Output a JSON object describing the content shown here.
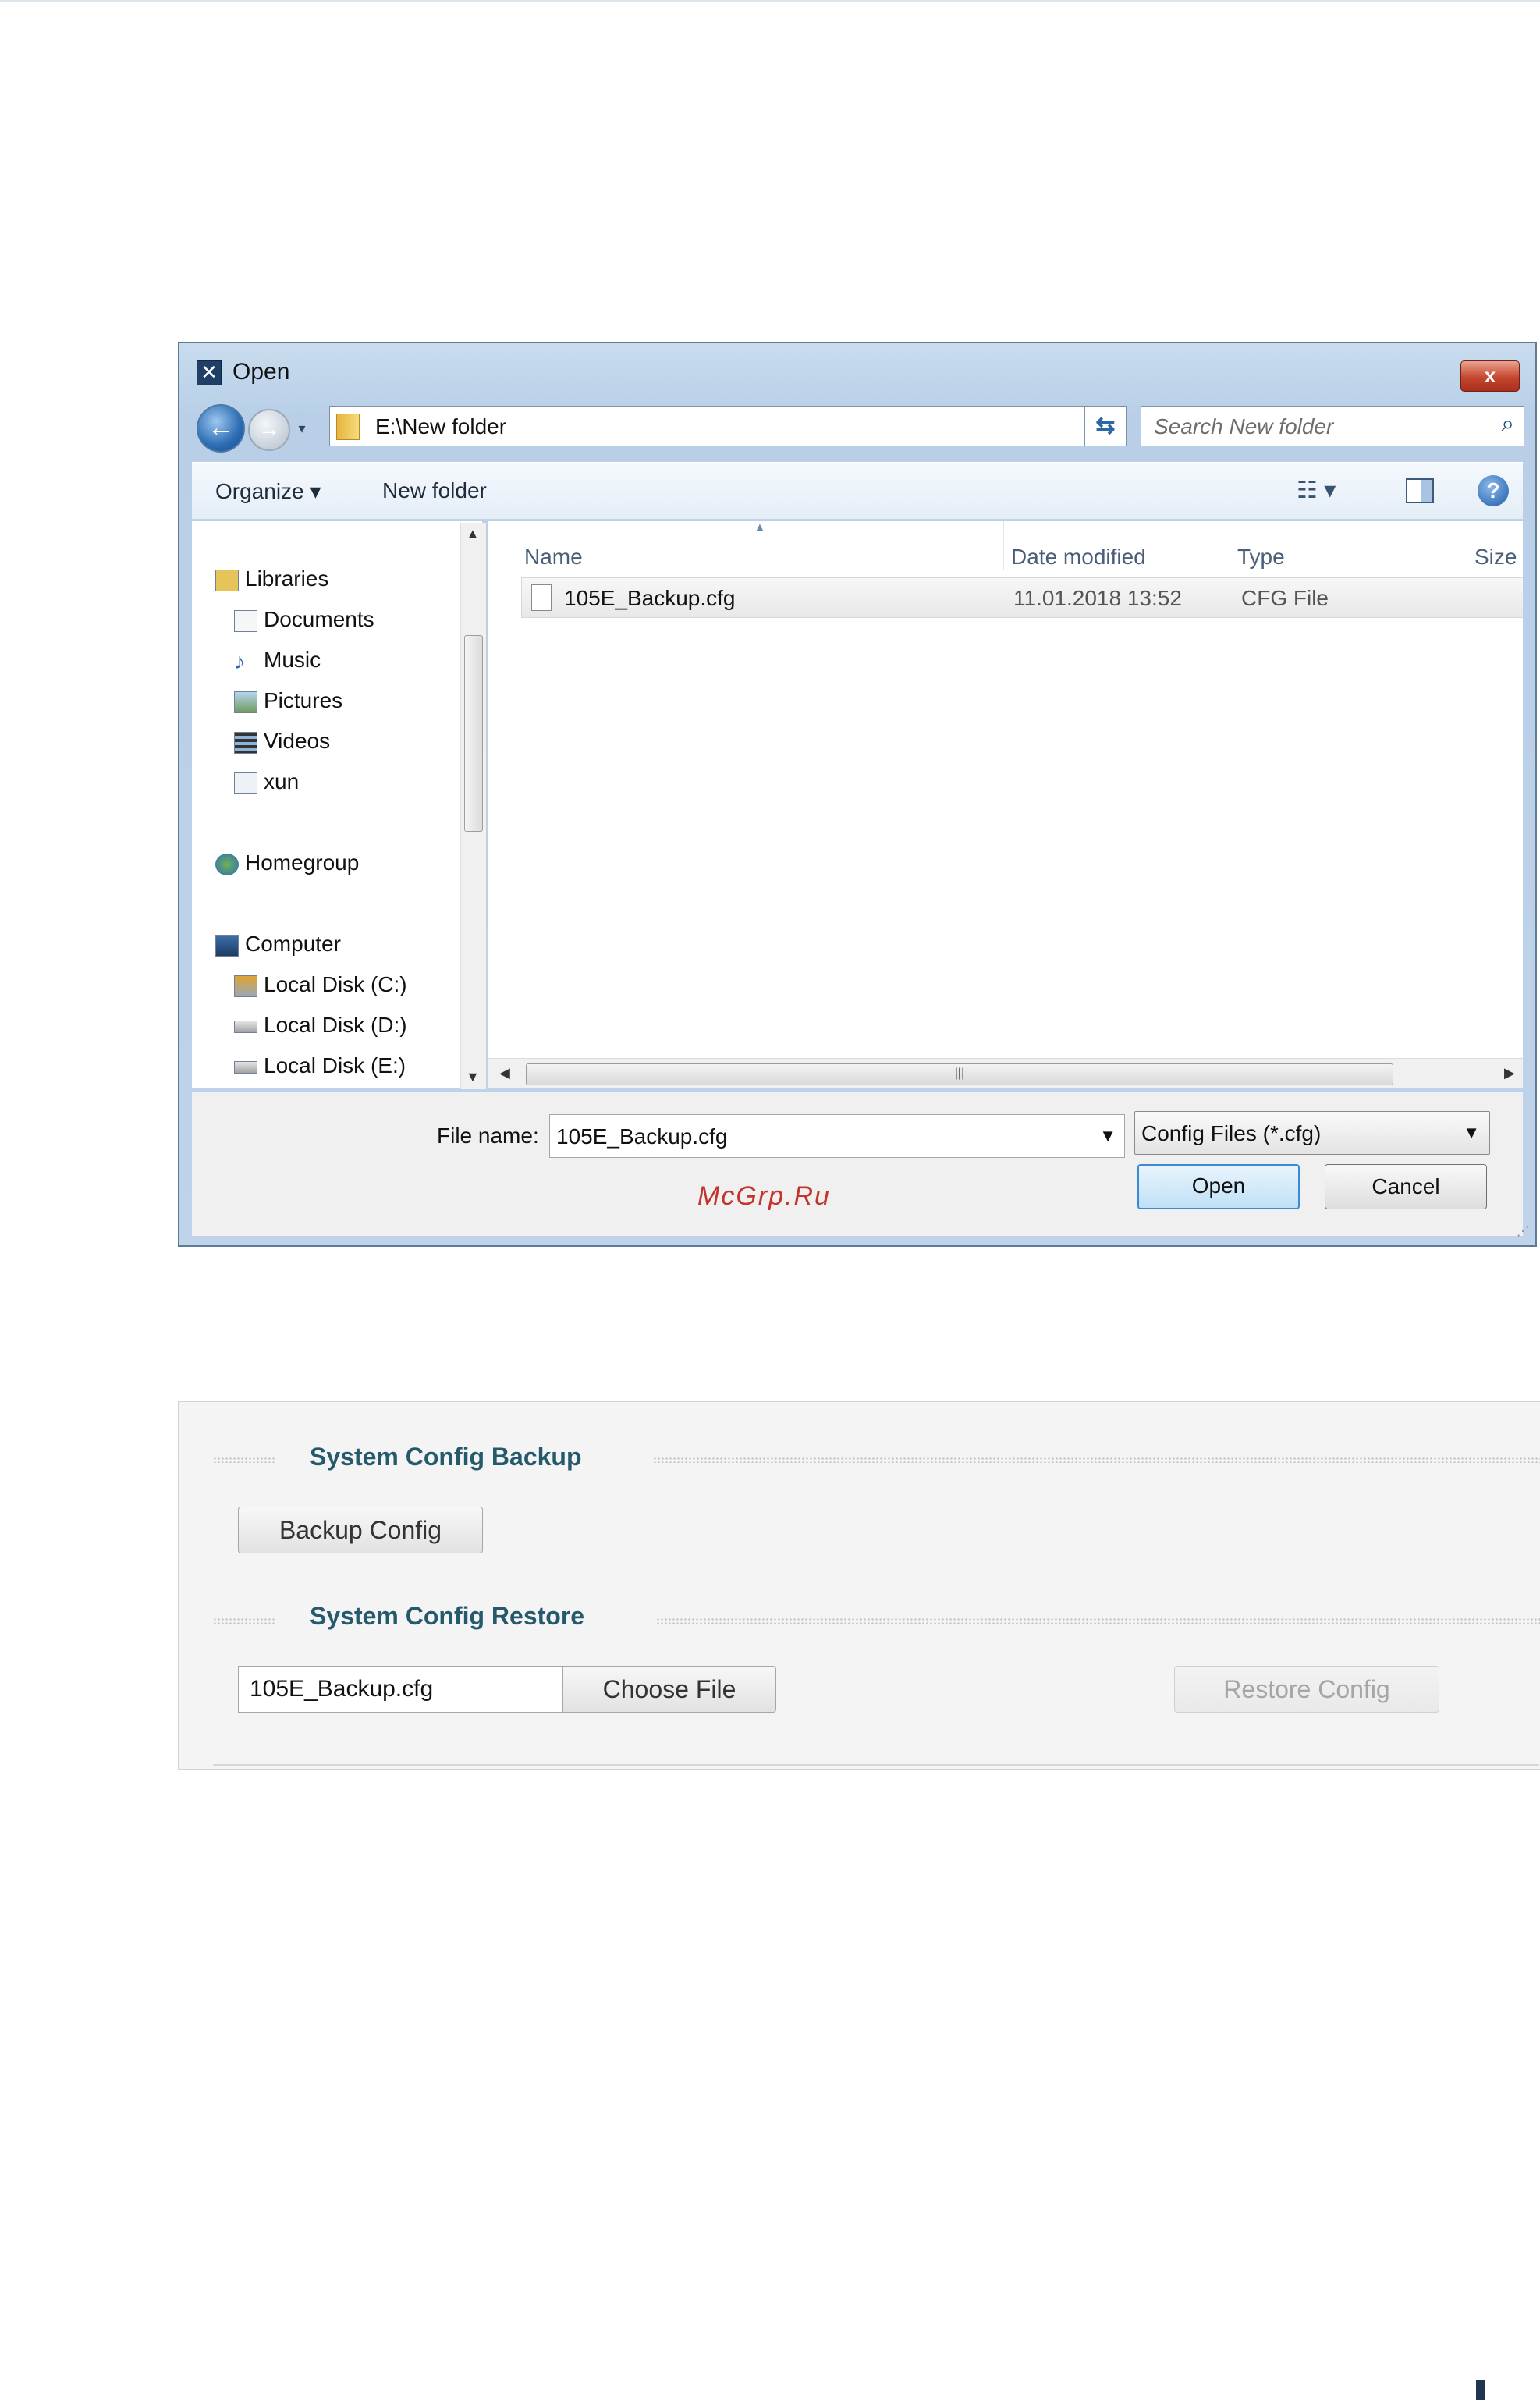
{
  "dialog": {
    "title": "Open",
    "close_label": "x",
    "address_path": "E:\\New folder",
    "search_placeholder": "Search New folder",
    "toolbar": {
      "organize_label": "Organize ▾",
      "new_folder_label": "New folder"
    },
    "nav": {
      "libraries": "Libraries",
      "documents": "Documents",
      "music": "Music",
      "pictures": "Pictures",
      "videos": "Videos",
      "xun": "xun",
      "homegroup": "Homegroup",
      "computer": "Computer",
      "disk_c": "Local Disk (C:)",
      "disk_d": "Local Disk (D:)",
      "disk_e": "Local Disk (E:)"
    },
    "columns": {
      "name": "Name",
      "date": "Date modified",
      "type": "Type",
      "size": "Size"
    },
    "files": [
      {
        "name": "105E_Backup.cfg",
        "date": "11.01.2018 13:52",
        "type": "CFG File"
      }
    ],
    "file_name_label": "File name:",
    "file_name_value": "105E_Backup.cfg",
    "filter_value": "Config Files (*.cfg)",
    "open_label": "Open",
    "cancel_label": "Cancel",
    "watermark": "McGrp.Ru"
  },
  "panel": {
    "backup_title": "System Config Backup",
    "backup_button": "Backup Config",
    "restore_title": "System Config Restore",
    "chosen_file": "105E_Backup.cfg",
    "choose_button": "Choose File",
    "restore_button": "Restore Config"
  },
  "icons": {
    "app": "dialog-app-icon",
    "back": "back-arrow-icon",
    "forward": "forward-arrow-icon",
    "folder": "folder-icon",
    "refresh": "refresh-icon",
    "search": "search-icon",
    "views": "view-options-icon",
    "preview": "preview-pane-icon",
    "help": "help-icon"
  },
  "colors": {
    "dialog_frame": "#bfd3ea",
    "close_button": "#c6462f",
    "section_title": "#245a6b",
    "watermark": "#c4342b"
  }
}
